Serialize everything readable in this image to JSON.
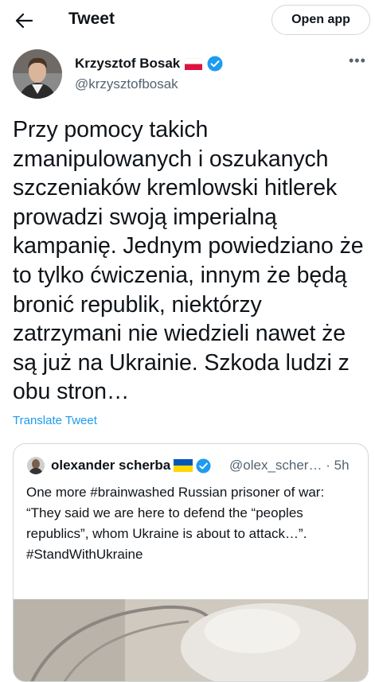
{
  "header": {
    "title": "Tweet",
    "open_app_label": "Open app"
  },
  "tweet": {
    "author_name": "Krzysztof Bosak",
    "author_handle": "@krzysztofbosak",
    "text": "Przy pomocy takich zmanipulowanych i oszukanych szczeniaków kremlowski hitlerek prowadzi swoją imperialną kampanię. Jednym powiedziano że to tylko ćwiczenia, innym że będą bronić republik, niektórzy zatrzymani nie wiedzieli nawet że są już na Ukrainie. Szkoda ludzi z obu stron…",
    "translate_label": "Translate Tweet",
    "more_label": "•••"
  },
  "quoted_tweet": {
    "author_name": "olexander scherba",
    "author_handle": "@olex_scher…",
    "separator": "·",
    "time": "5h",
    "text": "One more #brainwashed Russian prisoner of war: “They said we are here to defend the “peoples republics”, whom Ukraine is about to attack…”.\n#StandWithUkraine"
  },
  "colors": {
    "accent": "#1d9bf0",
    "verified": "#1d9bf0",
    "text": "#0f1419",
    "muted": "#536471",
    "border": "#cfd9de"
  },
  "icons": [
    "back-arrow-icon",
    "poland-flag-icon",
    "verified-badge-icon",
    "more-icon",
    "ukraine-flag-icon"
  ]
}
